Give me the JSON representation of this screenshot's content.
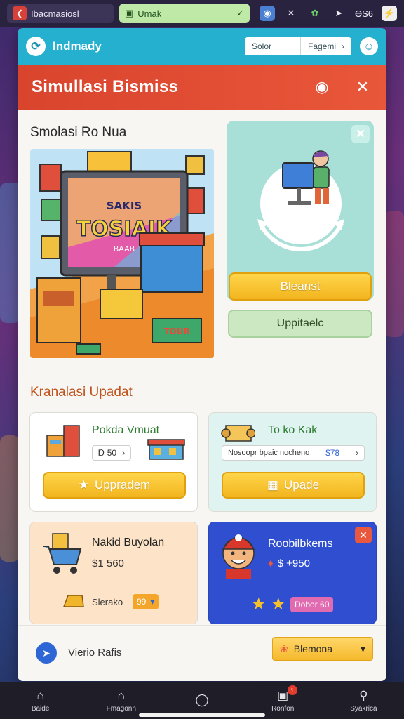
{
  "statusbar": {
    "tab1_label": "Ibacmasiosl",
    "tab2_label": "Umak",
    "right_text": "ӨS6"
  },
  "topbar": {
    "brand": "Indmady",
    "select_label": "Solor",
    "button_label": "Fagemi"
  },
  "titlebar": {
    "title": "Simullasi Bismiss"
  },
  "section1": {
    "title": "Smolasi Ro Nua",
    "billboard_small": "SAKIS",
    "billboard_main": "TOSIAIK",
    "billboard_sub": "BAAB",
    "mini_sign": "TOUR",
    "primary_button": "Bleanst",
    "secondary_button": "Uppitaelc"
  },
  "section2": {
    "title": "Kranalasi Upadat",
    "cards": [
      {
        "title": "Pokda Vmuat",
        "pill": "Ɒ 50",
        "button": "Uppradem"
      },
      {
        "title": "To ko Kak",
        "pill": "Nosoopr bpaic nocheno",
        "pill_value": "$78",
        "button": "Upade"
      },
      {
        "title": "Nakid Buyolan",
        "price": "$1 560",
        "badge_label": "Slerako",
        "badge_value": "99"
      },
      {
        "title": "Roobilbkems",
        "price": "$ +950",
        "badge_value": "Dobor 60"
      }
    ]
  },
  "footer": {
    "label": "Vierio Rafis",
    "button": "Blemona"
  },
  "nav": [
    {
      "label": "Baide"
    },
    {
      "label": "Fmagonn"
    },
    {
      "label": ""
    },
    {
      "label": "Ronfon",
      "badge": "1"
    },
    {
      "label": "Syakrica"
    }
  ],
  "colors": {
    "accent_teal": "#26b0cf",
    "title_red": "#d9442d",
    "button_yellow": "#f2b51f"
  }
}
